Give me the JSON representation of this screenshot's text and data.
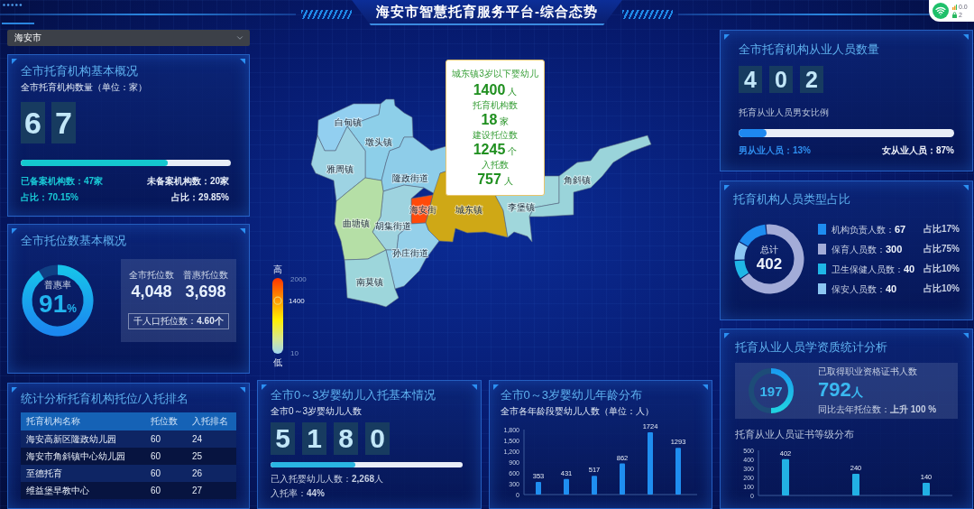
{
  "header": {
    "title": "海安市智慧托育服务平台-综合态势"
  },
  "net_widget": {
    "speed": "0.0",
    "count": "2"
  },
  "region_select": {
    "value": "海安市"
  },
  "institutions": {
    "title": "全市托育机构基本概况",
    "subtitle": "全市托育机构数量（单位：家）",
    "digits": [
      "6",
      "7"
    ],
    "level": 0.7015,
    "stats": [
      {
        "text": "已备案机构数：**47**家",
        "kind": "primary"
      },
      {
        "text": "未备案机构数：**20**家",
        "kind": "secondary"
      },
      {
        "text": "占比：**70.15%**",
        "kind": "primary"
      },
      {
        "text": "占比：**29.85%**",
        "kind": "secondary"
      }
    ]
  },
  "slots": {
    "title": "全市托位数基本概况",
    "rate_label": "普惠率",
    "rate": "91",
    "rate_unit": "%",
    "stats": [
      {
        "label": "全市托位数",
        "value": "4,048"
      },
      {
        "label": "普惠托位数",
        "value": "3,698"
      }
    ],
    "per_thousand": "千人口托位数：**4.60个**"
  },
  "ranking": {
    "title": "统计分析托育机构托位/入托排名",
    "columns": [
      "托育机构名称",
      "托位数",
      "入托排名"
    ],
    "rows": [
      {
        "name": "海安高新区隆政幼儿园",
        "seats": "60",
        "rank": "24"
      },
      {
        "name": "海安市角斜镇中心幼儿园",
        "seats": "60",
        "rank": "25"
      },
      {
        "name": "至德托育",
        "seats": "60",
        "rank": "26"
      },
      {
        "name": "维益堡早教中心",
        "seats": "60",
        "rank": "27"
      }
    ]
  },
  "map": {
    "regions": [
      {
        "name": "白甸镇",
        "color": "#92cff0"
      },
      {
        "name": "墩头镇",
        "color": "#8dcfe9"
      },
      {
        "name": "雅周镇",
        "color": "#9dd3e3"
      },
      {
        "name": "隆政街道",
        "color": "#8ecde9"
      },
      {
        "name": "海安街",
        "color": "#ff4a0a"
      },
      {
        "name": "城东镇",
        "color": "#cfa816"
      },
      {
        "name": "胡集街道",
        "color": "#9ed3df"
      },
      {
        "name": "曲塘镇",
        "color": "#b5dfa6"
      },
      {
        "name": "孙庄街道",
        "color": "#94d0ea"
      },
      {
        "name": "南莫镇",
        "color": "#9dd6db"
      },
      {
        "name": "李堡镇",
        "color": "#a0d7dc"
      },
      {
        "name": "角斜镇",
        "color": "#9ad4da"
      }
    ],
    "legend": {
      "high": "高",
      "low": "低",
      "max": "2000",
      "min": "10",
      "reading": "1400",
      "level": 0.7
    },
    "tooltip": {
      "title": "城东镇3岁以下婴幼儿",
      "value": "1400",
      "unit": "人",
      "metrics": [
        {
          "label": "托育机构数",
          "value": "18",
          "unit": "家"
        },
        {
          "label": "建设托位数",
          "value": "1245",
          "unit": "个"
        },
        {
          "label": "入托数",
          "value": "757",
          "unit": "人"
        }
      ]
    }
  },
  "enrollment": {
    "title": "全市0～3岁婴幼儿入托基本情况",
    "subtitle": "全市0～3岁婴幼儿人数",
    "digits": [
      "5",
      "1",
      "8",
      "0"
    ],
    "level": 0.44,
    "enrolled": "已入托婴幼儿人数：**2,268**人",
    "rate": "入托率：**44%**"
  },
  "age_distribution": {
    "title": "全市0～3岁婴幼儿年龄分布",
    "subtitle": "全市各年龄段婴幼儿人数（单位：人）",
    "chart_data": {
      "type": "bar",
      "values": [
        353,
        431,
        517,
        862,
        1724,
        1293
      ],
      "ylim": [
        0,
        1800
      ],
      "yticks": [
        0,
        300,
        600,
        900,
        {
          "value": 1200,
          "label": "1,200"
        },
        {
          "value": 1500,
          "label": "1,500"
        },
        {
          "value": 1800,
          "label": "1,800"
        }
      ],
      "data_labels": true
    }
  },
  "staff": {
    "title": "全市托育机构从业人员数量",
    "digits": [
      "4",
      "0",
      "2"
    ],
    "ratio_label": "托育从业人员男女比例",
    "level": 0.13,
    "male": "男从业人员：13%",
    "female": "女从业人员：87%"
  },
  "staff_types": {
    "title": "托育机构人员类型占比",
    "total_label": "总计",
    "total": "402",
    "items": [
      {
        "label": "机构负责人数：",
        "value": "67",
        "share": "占比17%",
        "color": "#1e8cf0"
      },
      {
        "label": "保育人员数：",
        "value": "300",
        "share": "占比75%",
        "color": "#a3acd8"
      },
      {
        "label": "卫生保健人员数：",
        "value": "40",
        "share": "占比10%",
        "color": "#1fb6e6"
      },
      {
        "label": "保安人员数：",
        "value": "40",
        "share": "占比10%",
        "color": "#8cc6f2"
      }
    ]
  },
  "qualification": {
    "title": "托育从业人员学资质统计分析",
    "ring_value": "197",
    "level": 0.5,
    "cert_label": "已取得职业资格证书人数",
    "cert_value": "792",
    "cert_unit": "人",
    "growth": "同比去年托位数：**上升 100 %**",
    "chart_title": "托育从业人员证书等级分布",
    "chart_data": {
      "type": "bar",
      "values": [
        402,
        240,
        140
      ],
      "ylim": [
        0,
        500
      ],
      "yticks": [
        0,
        100,
        200,
        300,
        400,
        500
      ],
      "data_labels": true
    }
  }
}
